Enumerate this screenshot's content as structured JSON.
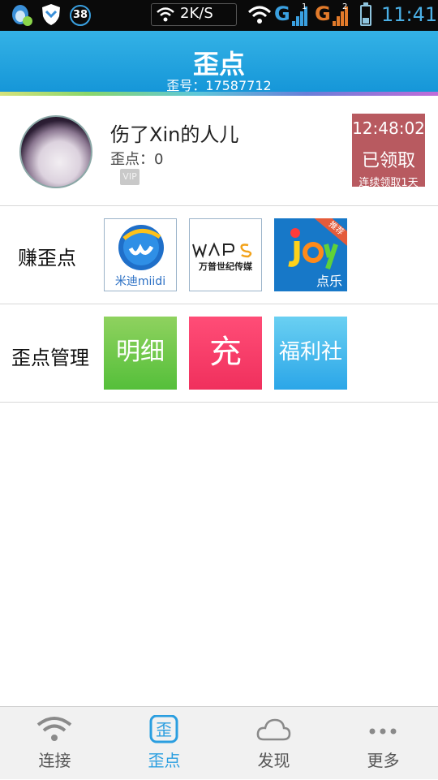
{
  "status_bar": {
    "notification_badge": "38",
    "net_speed": "2K/S",
    "sim1_network": "G",
    "sim1_slot": "1",
    "sim2_network": "G",
    "sim2_slot": "2",
    "battery_level": 0.3,
    "time": "11:41",
    "icons": [
      "qq-icon",
      "shield-icon",
      "wifi-icon",
      "signal-icon",
      "battery-icon"
    ]
  },
  "header": {
    "title": "歪点",
    "subtitle": "歪号：17587712"
  },
  "profile": {
    "name": "伤了Xin的人儿",
    "points": "歪点：0",
    "vip_label": "VIP",
    "claim": {
      "time": "12:48:02",
      "status": "已领取",
      "streak": "连续领取1天"
    }
  },
  "earn": {
    "label": "赚歪点",
    "partners": [
      {
        "name": "米迪miidi",
        "icon": "miidi-logo"
      },
      {
        "name": "万普世纪传媒",
        "icon": "waps-logo"
      },
      {
        "name": "点乐",
        "ribbon": "推荐",
        "icon": "joy-logo"
      }
    ]
  },
  "manage": {
    "label": "歪点管理",
    "buttons": [
      {
        "label": "明细",
        "color": "#6cc84a"
      },
      {
        "label": "充",
        "color": "#f43a67"
      },
      {
        "label": "福利社",
        "color": "#45b8ee"
      }
    ]
  },
  "nav": {
    "active_index": 1,
    "accent": "#2a9ee0",
    "items": [
      {
        "label": "连接",
        "icon": "wifi-icon"
      },
      {
        "label": "歪点",
        "icon": "points-icon",
        "icon_text": "歪"
      },
      {
        "label": "发现",
        "icon": "cloud-icon"
      },
      {
        "label": "更多",
        "icon": "more-dots-icon"
      }
    ]
  }
}
